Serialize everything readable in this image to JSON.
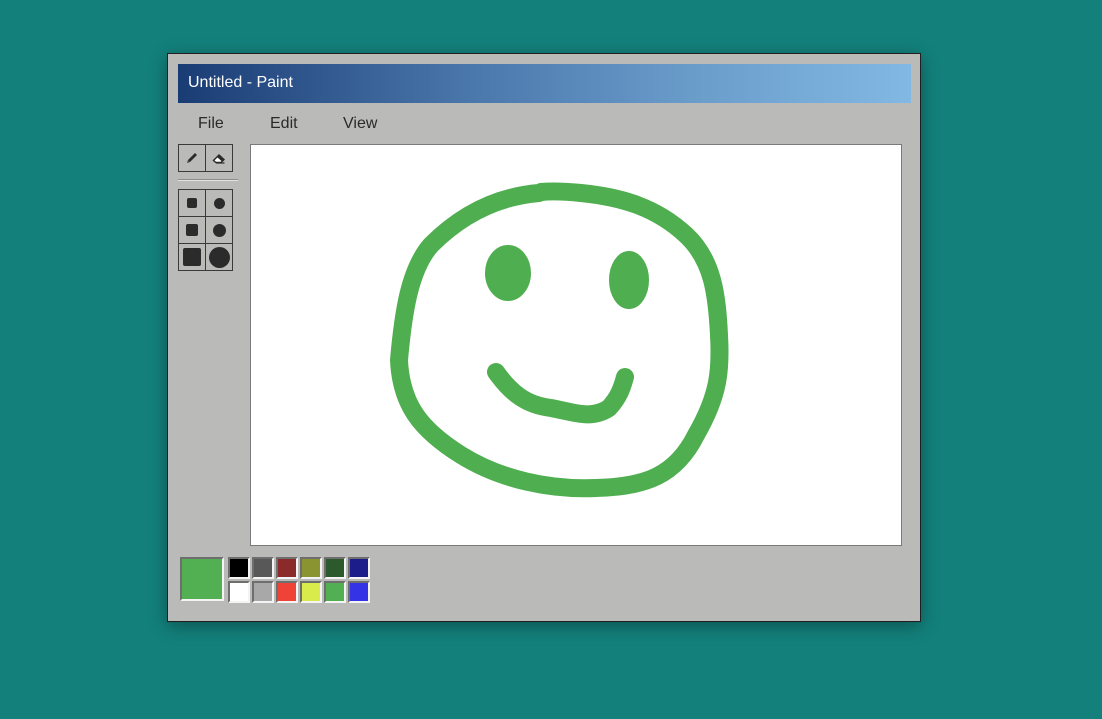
{
  "window": {
    "title": "Untitled - Paint"
  },
  "menu": [
    {
      "label": "File"
    },
    {
      "label": "Edit"
    },
    {
      "label": "View"
    }
  ],
  "tools": [
    {
      "name": "pencil",
      "icon": "pencil-icon"
    },
    {
      "name": "eraser",
      "icon": "eraser-icon"
    }
  ],
  "brush_sizes": [
    {
      "shape": "square",
      "size": "small"
    },
    {
      "shape": "circle",
      "size": "small"
    },
    {
      "shape": "square",
      "size": "medium"
    },
    {
      "shape": "circle",
      "size": "medium"
    },
    {
      "shape": "square",
      "size": "large"
    },
    {
      "shape": "circle",
      "size": "large"
    }
  ],
  "canvas": {
    "drawing": "green smiley face",
    "stroke_color": "#4fae4f"
  },
  "palette": {
    "current_color": "#52b052",
    "colors": [
      "#000000",
      "#585858",
      "#8b2a2a",
      "#8a9431",
      "#2c5a2c",
      "#1c1c8a",
      "#ffffff",
      "#a8a8a8",
      "#ef4338",
      "#d9ea4b",
      "#52b052",
      "#3434e6"
    ]
  },
  "colors": {
    "desktop": "#13807b",
    "window_bg": "#babbb9",
    "titlebar_start": "#1a3c74",
    "titlebar_end": "#82b8e4"
  }
}
